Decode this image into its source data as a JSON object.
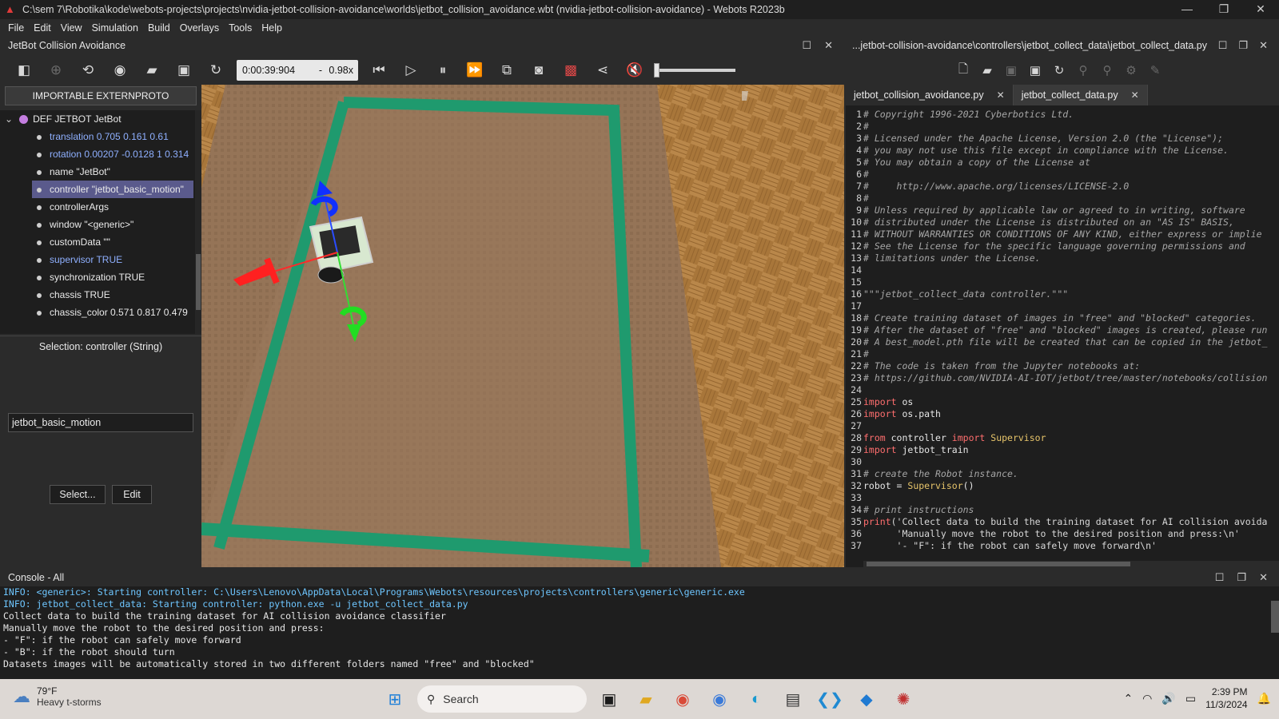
{
  "window": {
    "title": "C:\\sem 7\\Robotika\\kode\\webots-projects\\projects\\nvidia-jetbot-collision-avoidance\\worlds\\jetbot_collision_avoidance.wbt (nvidia-jetbot-collision-avoidance) - Webots R2023b"
  },
  "menu": [
    "File",
    "Edit",
    "View",
    "Simulation",
    "Build",
    "Overlays",
    "Tools",
    "Help"
  ],
  "left_panel": {
    "title": "JetBot Collision Avoidance"
  },
  "right_panel": {
    "title": "...jetbot-collision-avoidance\\controllers\\jetbot_collect_data\\jetbot_collect_data.py"
  },
  "toolbar": {
    "time": "0:00:39:904",
    "sep": "-",
    "speed": "0.98x"
  },
  "scene_tree": {
    "extern_button": "IMPORTABLE EXTERNPROTO",
    "root": "DEF JETBOT JetBot",
    "fields": [
      {
        "label": "translation 0.705 0.161 0.61",
        "color": "blue"
      },
      {
        "label": "rotation 0.00207 -0.0128 1 0.314",
        "color": "blue"
      },
      {
        "label": "name \"JetBot\"",
        "color": "white"
      },
      {
        "label": "controller \"jetbot_basic_motion\"",
        "color": "white",
        "selected": true
      },
      {
        "label": "controllerArgs",
        "color": "white"
      },
      {
        "label": "window \"<generic>\"",
        "color": "white"
      },
      {
        "label": "customData \"\"",
        "color": "white"
      },
      {
        "label": "supervisor TRUE",
        "color": "blue"
      },
      {
        "label": "synchronization TRUE",
        "color": "white"
      },
      {
        "label": "chassis TRUE",
        "color": "white"
      },
      {
        "label": "chassis_color 0.571 0.817 0.479",
        "color": "white"
      }
    ]
  },
  "field_editor": {
    "selection": "Selection: controller (String)",
    "value": "jetbot_basic_motion",
    "select_btn": "Select...",
    "edit_btn": "Edit"
  },
  "editor": {
    "tabs": [
      {
        "label": "jetbot_collision_avoidance.py"
      },
      {
        "label": "jetbot_collect_data.py"
      }
    ],
    "close": "✕"
  },
  "console": {
    "title": "Console - All",
    "lines": [
      {
        "type": "info",
        "text": "INFO: <generic>: Starting controller: C:\\Users\\Lenovo\\AppData\\Local\\Programs\\Webots\\resources\\projects\\controllers\\generic\\generic.exe"
      },
      {
        "type": "info",
        "text": "INFO: jetbot_collect_data: Starting controller: python.exe -u jetbot_collect_data.py"
      },
      {
        "type": "out",
        "text": "Collect data to build the training dataset for AI collision avoidance classifier"
      },
      {
        "type": "out",
        "text": "Manually move the robot to the desired position and press:"
      },
      {
        "type": "out",
        "text": "- \"F\": if the robot can safely move forward"
      },
      {
        "type": "out",
        "text": "- \"B\": if the robot should turn"
      },
      {
        "type": "out",
        "text": "Datasets images will be automatically stored in two different folders named \"free\" and \"blocked\""
      }
    ]
  },
  "taskbar": {
    "temp": "79°F",
    "weather": "Heavy t-storms",
    "search": "Search",
    "time": "2:39 PM",
    "date": "11/3/2024"
  },
  "colors": {
    "track": "#1f9a6e",
    "floor": "#8a6d52",
    "parquet": "#b07f3e"
  }
}
